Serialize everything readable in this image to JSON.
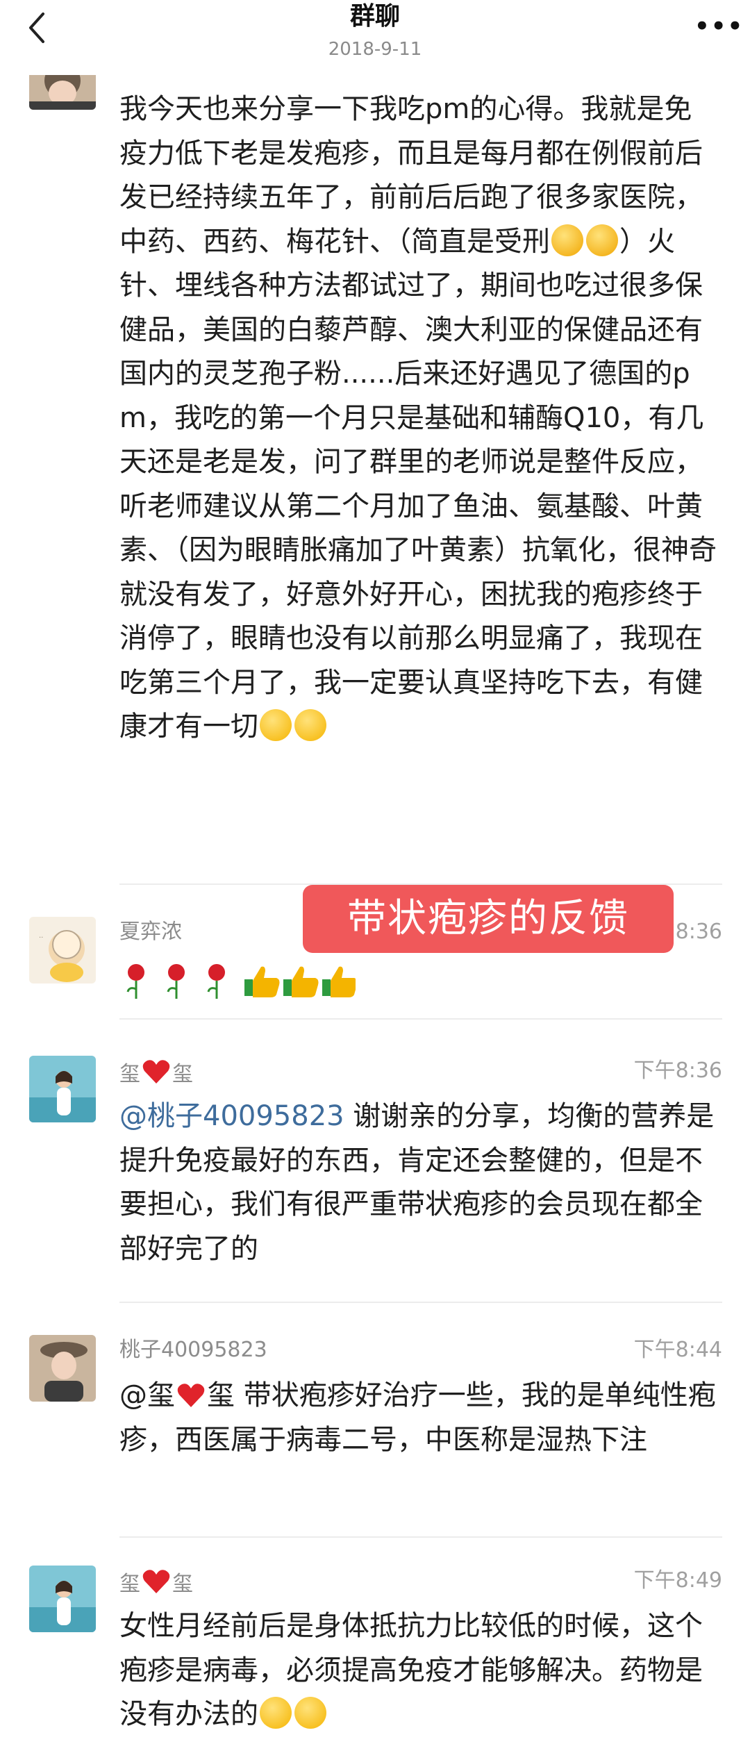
{
  "header": {
    "title": "群聊",
    "date": "2018-9-11",
    "more_label": "•••"
  },
  "messages": [
    {
      "sender": "",
      "time": "",
      "text_parts": [
        "我今天也来分享一下我吃pm的心得。我就是免疫力低下老是发疱疹，而且是每月都在例假前后发已经持续五年了，前前后后跑了很多家医院，中药、西药、梅花针、（简直是受刑",
        "）火针、埋线各种方法都试过了，期间也吃过很多保健品，美国的白藜芦醇、澳大利亚的保健品还有国内的灵芝孢子粉......后来还好遇见了德国的pm，我吃的第一个月只是基础和辅酶Q10，有几天还是老是发，问了群里的老师说是整件反应，听老师建议从第二个月加了鱼油、氨基酸、叶黄素、（因为眼睛胀痛加了叶黄素）抗氧化，很神奇就没有发了，好意外好开心，困扰我的疱疹终于消停了，眼睛也没有以前那么明显痛了，我现在吃第三个月了，我一定要认真坚持吃下去，有健康才有一切"
      ]
    },
    {
      "sender": "夏弈浓",
      "time": "8:36",
      "emoji_note": "🌹🌹🌹👍👍👍"
    },
    {
      "sender_left": "玺",
      "sender_right": "玺",
      "time": "下午8:36",
      "mention": "@桃子40095823",
      "text": " 谢谢亲的分享，均衡的营养是提升免疫最好的东西，肯定还会整健的，但是不要担心，我们有很严重带状疱疹的会员现在都全部好完了的"
    },
    {
      "sender": "桃子40095823",
      "time": "下午8:44",
      "mention_left": "@玺",
      "mention_right": "玺",
      "text": " 带状疱疹好治疗一些，我的是单纯性疱疹，西医属于病毒二号，中医称是湿热下注"
    },
    {
      "sender_left": "玺",
      "sender_right": "玺",
      "time": "下午8:49",
      "text": "女性月经前后是身体抵抗力比较低的时候，这个疱疹是病毒，必须提高免疫才能够解决。药物是没有办法的"
    }
  ],
  "banner": {
    "text": "带状疱疹的反馈"
  },
  "icons": {
    "back": "chevron-left-icon",
    "more": "more-dots-icon",
    "heart": "heart-icon",
    "rose": "rose-icon",
    "thumbs_up": "thumbs-up-icon",
    "smile": "smile-emoji-icon",
    "cry": "crying-emoji-icon"
  },
  "colors": {
    "mention": "#3e6c9c",
    "banner": "#f0585a",
    "timestamp": "#a0a0a0",
    "sender": "#8c8c8c"
  }
}
